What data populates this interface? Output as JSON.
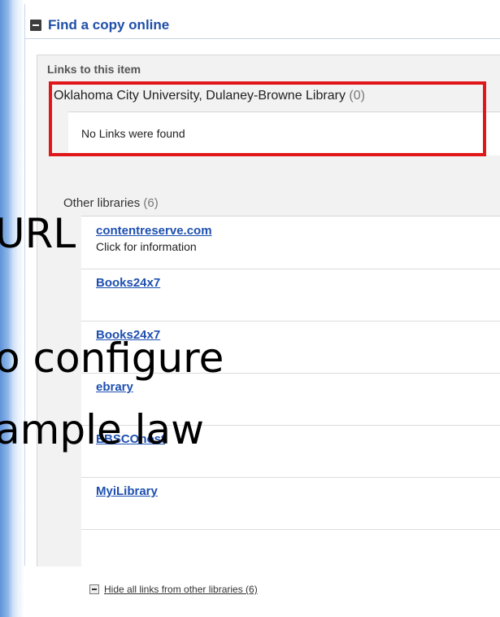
{
  "header": {
    "title": "Find a copy online"
  },
  "section": {
    "title": "Links to this item",
    "local_library": {
      "name": "Oklahoma City University, Dulaney-Browne Library",
      "count": "(0)"
    },
    "no_links_text": "No Links were found"
  },
  "other_libraries": {
    "title": "Other libraries",
    "count": "(6)",
    "items": [
      {
        "name": "contentreserve.com",
        "sub": "Click for information"
      },
      {
        "name": "Books24x7"
      },
      {
        "name": "Books24x7"
      },
      {
        "name": "ebrary"
      },
      {
        "name": "EBSCOhost"
      },
      {
        "name": "MyiLibrary"
      }
    ],
    "hide_label": "Hide all links from other libraries (6)"
  },
  "overlay": {
    "lines": [
      "URL",
      "o configure",
      "ample law"
    ]
  },
  "colors": {
    "highlight": "#e0161b",
    "link": "#1e4fb0",
    "title": "#1f4fa8"
  }
}
